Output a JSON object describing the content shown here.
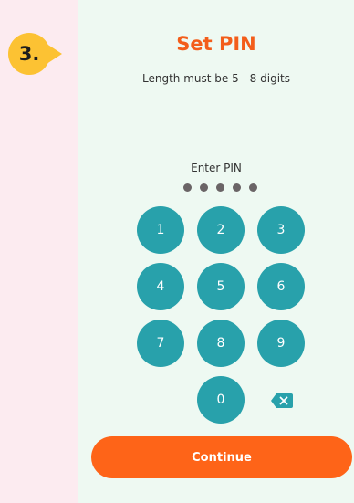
{
  "step": {
    "label": "3."
  },
  "header": {
    "title": "Set PIN",
    "subtitle": "Length must be 5 - 8 digits"
  },
  "pin": {
    "label": "Enter PIN",
    "entered_digits": 5,
    "dot_color": "#6a6466"
  },
  "keypad": {
    "keys": [
      "1",
      "2",
      "3",
      "4",
      "5",
      "6",
      "7",
      "8",
      "9",
      "0"
    ],
    "key_color": "#28a1ab",
    "backspace_icon": "backspace-icon"
  },
  "actions": {
    "continue_label": "Continue",
    "continue_color": "#fe6418"
  },
  "colors": {
    "accent_title": "#f35d1a",
    "badge": "#fcc233",
    "panel_bg": "#eef9f2",
    "page_bg": "#fcebf0"
  }
}
